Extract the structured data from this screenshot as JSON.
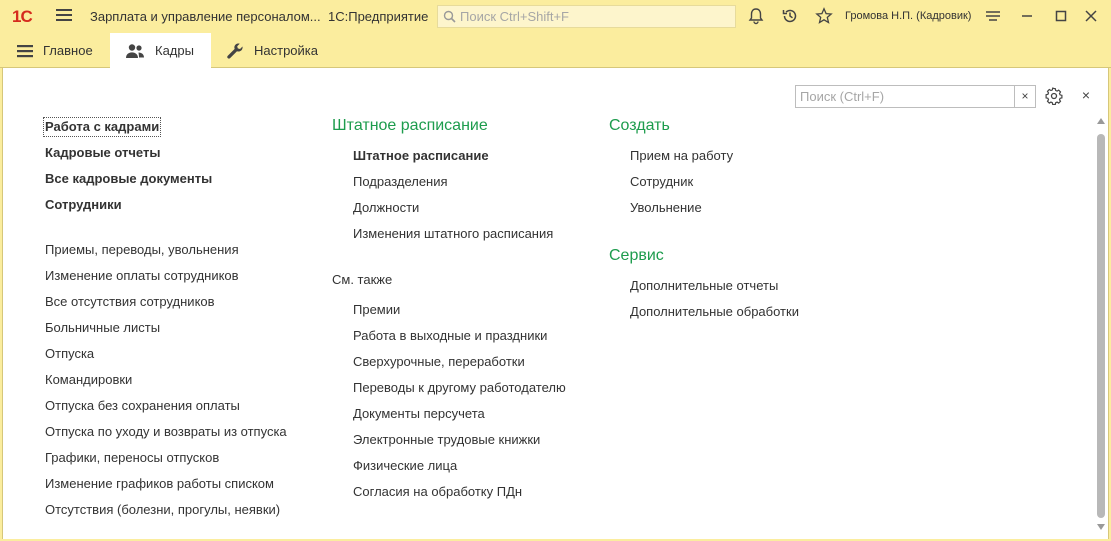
{
  "window": {
    "title": "Зарплата и управление персоналом...",
    "platform": "1С:Предприятие",
    "search_placeholder": "Поиск Ctrl+Shift+F",
    "user": "Громова Н.П. (Кадровик)"
  },
  "sections": [
    {
      "label": "Главное",
      "icon": "hamburger-icon"
    },
    {
      "label": "Кадры",
      "icon": "people-icon",
      "active": true
    },
    {
      "label": "Настройка",
      "icon": "wrench-icon"
    }
  ],
  "panel": {
    "search_placeholder": "Поиск (Ctrl+F)",
    "clear_label": "×",
    "close_label": "×"
  },
  "col1": {
    "bold": [
      "Работа с кадрами",
      "Кадровые отчеты",
      "Все кадровые документы",
      "Сотрудники"
    ],
    "items": [
      "Приемы, переводы, увольнения",
      "Изменение оплаты сотрудников",
      "Все отсутствия сотрудников",
      "Больничные листы",
      "Отпуска",
      "Командировки",
      "Отпуска без сохранения оплаты",
      "Отпуска по уходу и возвраты из отпуска",
      "Графики, переносы отпусков",
      "Изменение графиков работы списком",
      "Отсутствия (болезни, прогулы, неявки)"
    ]
  },
  "col2": {
    "group_title": "Штатное расписание",
    "bold_item": "Штатное расписание",
    "items": [
      "Подразделения",
      "Должности",
      "Изменения штатного расписания"
    ],
    "see_also": "См. также",
    "see_items": [
      "Премии",
      "Работа в выходные и праздники",
      "Сверхурочные, переработки",
      "Переводы к другому работодателю",
      "Документы персучета",
      "Электронные трудовые книжки",
      "Физические лица",
      "Согласия на обработку ПДн"
    ]
  },
  "col3": {
    "create_title": "Создать",
    "create_items": [
      "Прием на работу",
      "Сотрудник",
      "Увольнение"
    ],
    "service_title": "Сервис",
    "service_items": [
      "Дополнительные отчеты",
      "Дополнительные обработки"
    ]
  },
  "colors": {
    "accent_bar": "#fbed9e",
    "group_title": "#1d9c4d",
    "logo": "#d52b1e"
  }
}
